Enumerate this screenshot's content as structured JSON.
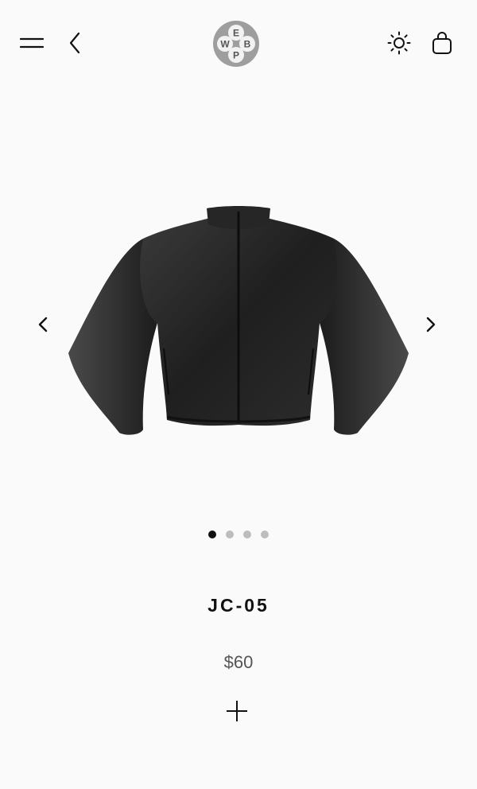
{
  "header": {
    "logo_letters": {
      "top": "E",
      "left": "W",
      "right": "B",
      "bottom": "P"
    },
    "icons": [
      "menu-icon",
      "back-chevron-icon",
      "sun-icon",
      "shopping-bag-icon"
    ]
  },
  "gallery": {
    "image_alt": "Black leather zip jacket",
    "slide_count": 4,
    "active_slide": 1
  },
  "product": {
    "name": "JC-05",
    "price": "$60"
  },
  "colors": {
    "background": "#fafafa",
    "text": "#111111",
    "price_text": "#555555",
    "dot_inactive": "#bdbdbd",
    "dot_active": "#111111"
  }
}
